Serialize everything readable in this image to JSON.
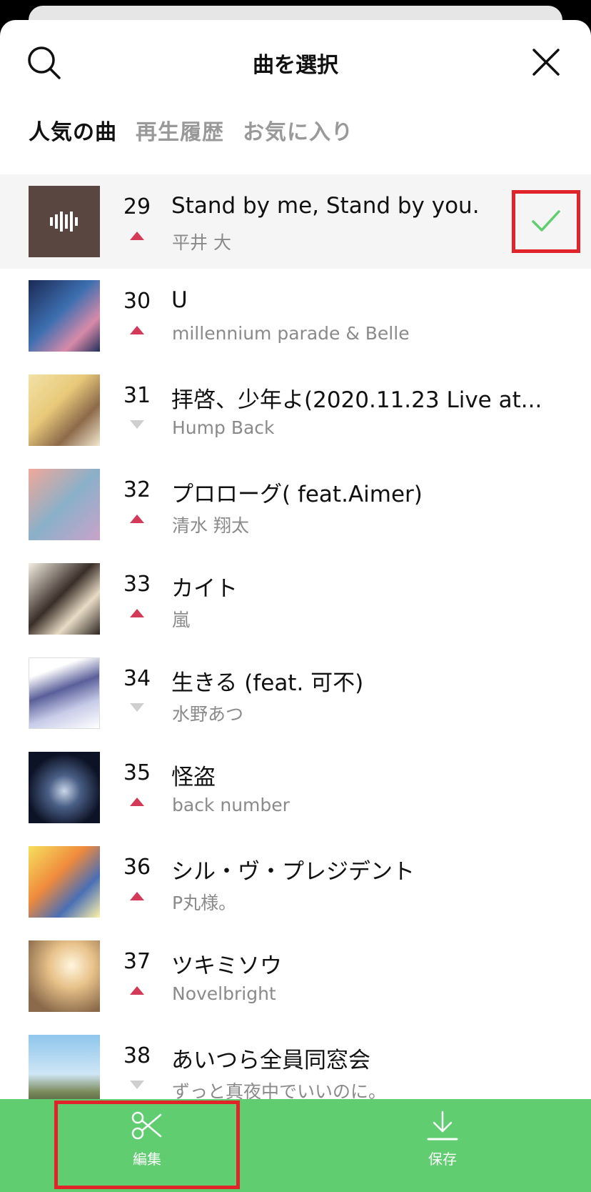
{
  "header": {
    "title": "曲を選択"
  },
  "tabs": [
    {
      "label": "人気の曲",
      "active": true
    },
    {
      "label": "再生履歴",
      "active": false
    },
    {
      "label": "お気に入り",
      "active": false
    }
  ],
  "songs": [
    {
      "rank": "29",
      "title": "Stand by me, Stand by you.",
      "artist": "平井 大",
      "trend": "up",
      "selected": true
    },
    {
      "rank": "30",
      "title": "U",
      "artist": "millennium parade & Belle",
      "trend": "up",
      "selected": false
    },
    {
      "rank": "31",
      "title": "拝啓、少年よ(2020.11.23 Live at...",
      "artist": "Hump Back",
      "trend": "down",
      "selected": false
    },
    {
      "rank": "32",
      "title": "プロローグ( feat.Aimer)",
      "artist": "清水 翔太",
      "trend": "up",
      "selected": false
    },
    {
      "rank": "33",
      "title": "カイト",
      "artist": "嵐",
      "trend": "up",
      "selected": false
    },
    {
      "rank": "34",
      "title": "生きる (feat. 可不)",
      "artist": "水野あつ",
      "trend": "down",
      "selected": false
    },
    {
      "rank": "35",
      "title": "怪盗",
      "artist": "back number",
      "trend": "up",
      "selected": false
    },
    {
      "rank": "36",
      "title": "シル・ヴ・プレジデント",
      "artist": "P丸様。",
      "trend": "up",
      "selected": false
    },
    {
      "rank": "37",
      "title": "ツキミソウ",
      "artist": "Novelbright",
      "trend": "up",
      "selected": false
    },
    {
      "rank": "38",
      "title": "あいつら全員同窓会",
      "artist": "ずっと真夜中でいいのに。",
      "trend": "down",
      "selected": false
    }
  ],
  "bottom_bar": {
    "edit_label": "編集",
    "save_label": "保存"
  },
  "colors": {
    "accent_green": "#5fcd70",
    "trend_up": "#d43a57",
    "trend_down": "#cfcfcf",
    "highlight_red": "#e0242a"
  }
}
